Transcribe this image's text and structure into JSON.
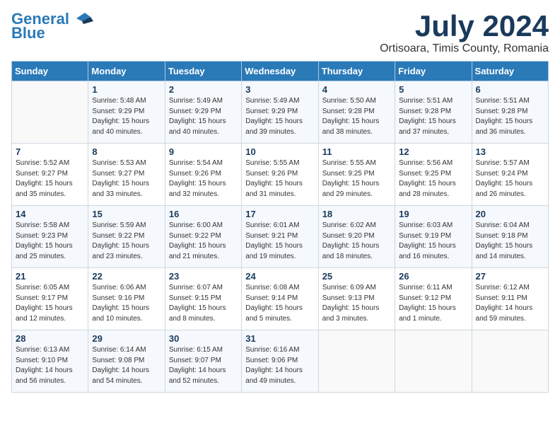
{
  "logo": {
    "line1": "General",
    "line2": "Blue"
  },
  "title": "July 2024",
  "subtitle": "Ortisoara, Timis County, Romania",
  "weekdays": [
    "Sunday",
    "Monday",
    "Tuesday",
    "Wednesday",
    "Thursday",
    "Friday",
    "Saturday"
  ],
  "weeks": [
    [
      {
        "day": "",
        "info": ""
      },
      {
        "day": "1",
        "info": "Sunrise: 5:48 AM\nSunset: 9:29 PM\nDaylight: 15 hours\nand 40 minutes."
      },
      {
        "day": "2",
        "info": "Sunrise: 5:49 AM\nSunset: 9:29 PM\nDaylight: 15 hours\nand 40 minutes."
      },
      {
        "day": "3",
        "info": "Sunrise: 5:49 AM\nSunset: 9:29 PM\nDaylight: 15 hours\nand 39 minutes."
      },
      {
        "day": "4",
        "info": "Sunrise: 5:50 AM\nSunset: 9:28 PM\nDaylight: 15 hours\nand 38 minutes."
      },
      {
        "day": "5",
        "info": "Sunrise: 5:51 AM\nSunset: 9:28 PM\nDaylight: 15 hours\nand 37 minutes."
      },
      {
        "day": "6",
        "info": "Sunrise: 5:51 AM\nSunset: 9:28 PM\nDaylight: 15 hours\nand 36 minutes."
      }
    ],
    [
      {
        "day": "7",
        "info": "Sunrise: 5:52 AM\nSunset: 9:27 PM\nDaylight: 15 hours\nand 35 minutes."
      },
      {
        "day": "8",
        "info": "Sunrise: 5:53 AM\nSunset: 9:27 PM\nDaylight: 15 hours\nand 33 minutes."
      },
      {
        "day": "9",
        "info": "Sunrise: 5:54 AM\nSunset: 9:26 PM\nDaylight: 15 hours\nand 32 minutes."
      },
      {
        "day": "10",
        "info": "Sunrise: 5:55 AM\nSunset: 9:26 PM\nDaylight: 15 hours\nand 31 minutes."
      },
      {
        "day": "11",
        "info": "Sunrise: 5:55 AM\nSunset: 9:25 PM\nDaylight: 15 hours\nand 29 minutes."
      },
      {
        "day": "12",
        "info": "Sunrise: 5:56 AM\nSunset: 9:25 PM\nDaylight: 15 hours\nand 28 minutes."
      },
      {
        "day": "13",
        "info": "Sunrise: 5:57 AM\nSunset: 9:24 PM\nDaylight: 15 hours\nand 26 minutes."
      }
    ],
    [
      {
        "day": "14",
        "info": "Sunrise: 5:58 AM\nSunset: 9:23 PM\nDaylight: 15 hours\nand 25 minutes."
      },
      {
        "day": "15",
        "info": "Sunrise: 5:59 AM\nSunset: 9:22 PM\nDaylight: 15 hours\nand 23 minutes."
      },
      {
        "day": "16",
        "info": "Sunrise: 6:00 AM\nSunset: 9:22 PM\nDaylight: 15 hours\nand 21 minutes."
      },
      {
        "day": "17",
        "info": "Sunrise: 6:01 AM\nSunset: 9:21 PM\nDaylight: 15 hours\nand 19 minutes."
      },
      {
        "day": "18",
        "info": "Sunrise: 6:02 AM\nSunset: 9:20 PM\nDaylight: 15 hours\nand 18 minutes."
      },
      {
        "day": "19",
        "info": "Sunrise: 6:03 AM\nSunset: 9:19 PM\nDaylight: 15 hours\nand 16 minutes."
      },
      {
        "day": "20",
        "info": "Sunrise: 6:04 AM\nSunset: 9:18 PM\nDaylight: 15 hours\nand 14 minutes."
      }
    ],
    [
      {
        "day": "21",
        "info": "Sunrise: 6:05 AM\nSunset: 9:17 PM\nDaylight: 15 hours\nand 12 minutes."
      },
      {
        "day": "22",
        "info": "Sunrise: 6:06 AM\nSunset: 9:16 PM\nDaylight: 15 hours\nand 10 minutes."
      },
      {
        "day": "23",
        "info": "Sunrise: 6:07 AM\nSunset: 9:15 PM\nDaylight: 15 hours\nand 8 minutes."
      },
      {
        "day": "24",
        "info": "Sunrise: 6:08 AM\nSunset: 9:14 PM\nDaylight: 15 hours\nand 5 minutes."
      },
      {
        "day": "25",
        "info": "Sunrise: 6:09 AM\nSunset: 9:13 PM\nDaylight: 15 hours\nand 3 minutes."
      },
      {
        "day": "26",
        "info": "Sunrise: 6:11 AM\nSunset: 9:12 PM\nDaylight: 15 hours\nand 1 minute."
      },
      {
        "day": "27",
        "info": "Sunrise: 6:12 AM\nSunset: 9:11 PM\nDaylight: 14 hours\nand 59 minutes."
      }
    ],
    [
      {
        "day": "28",
        "info": "Sunrise: 6:13 AM\nSunset: 9:10 PM\nDaylight: 14 hours\nand 56 minutes."
      },
      {
        "day": "29",
        "info": "Sunrise: 6:14 AM\nSunset: 9:08 PM\nDaylight: 14 hours\nand 54 minutes."
      },
      {
        "day": "30",
        "info": "Sunrise: 6:15 AM\nSunset: 9:07 PM\nDaylight: 14 hours\nand 52 minutes."
      },
      {
        "day": "31",
        "info": "Sunrise: 6:16 AM\nSunset: 9:06 PM\nDaylight: 14 hours\nand 49 minutes."
      },
      {
        "day": "",
        "info": ""
      },
      {
        "day": "",
        "info": ""
      },
      {
        "day": "",
        "info": ""
      }
    ]
  ]
}
